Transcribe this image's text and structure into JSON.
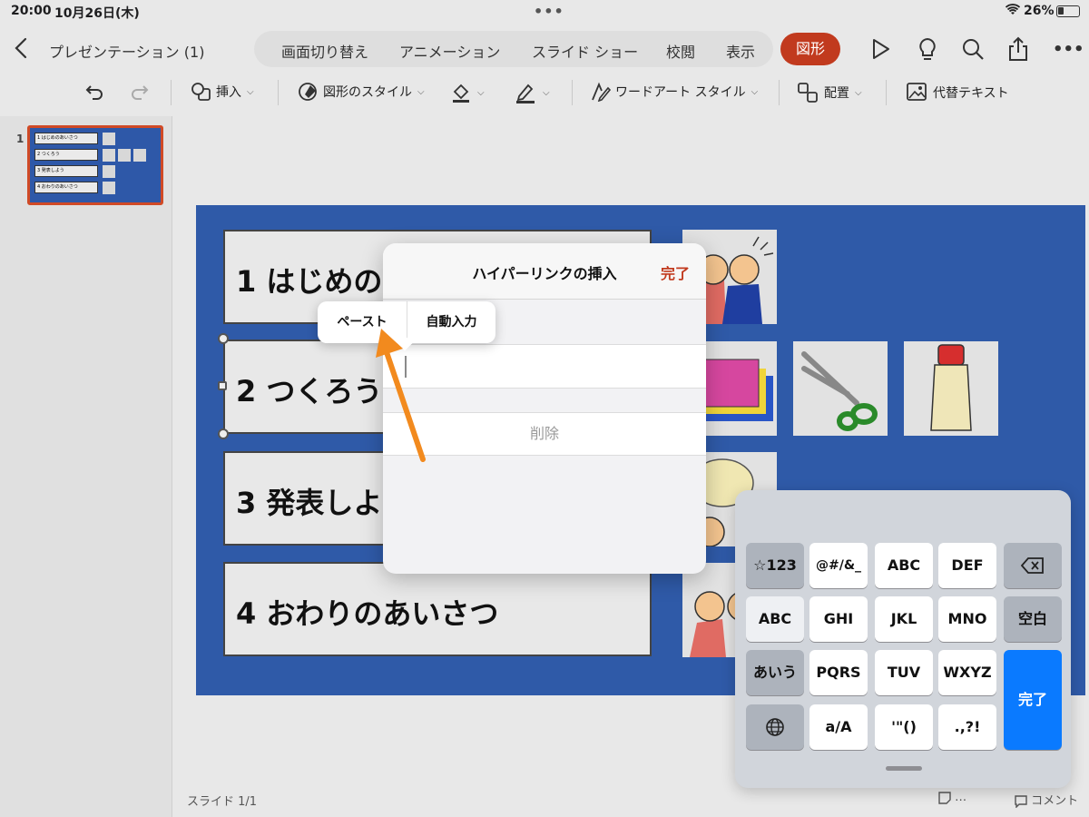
{
  "status_bar": {
    "time": "20:00",
    "date": "10月26日(木)",
    "battery": "26%"
  },
  "doc": {
    "title": "プレゼンテーション (1)"
  },
  "tabs": [
    {
      "label": "画面切り替え"
    },
    {
      "label": "アニメーション"
    },
    {
      "label": "スライド ショー"
    },
    {
      "label": "校閲"
    },
    {
      "label": "表示"
    }
  ],
  "active_tab": {
    "label": "図形"
  },
  "accent_color": "#c13a1e",
  "ribbon": {
    "insert": "挿入",
    "shape_style": "図形のスタイル",
    "wordart": "ワードアート スタイル",
    "arrange": "配置",
    "alt_text": "代替テキスト"
  },
  "thumbnail": {
    "number": "1",
    "items": [
      "1 はじめのあいさつ",
      "2 つくろう",
      "3 発表しよう",
      "4 おわりのあいさつ"
    ]
  },
  "slide": {
    "items": [
      "1 はじめの",
      "2 つくろう",
      "3 発表しよ",
      "4 おわりのあいさつ"
    ]
  },
  "dialog": {
    "title": "ハイパーリンクの挿入",
    "done": "完了",
    "delete": "削除"
  },
  "popover": {
    "paste": "ペースト",
    "autofill": "自動入力"
  },
  "keyboard": {
    "row1": [
      "☆123",
      "@#/&_",
      "ABC",
      "DEF"
    ],
    "row2": [
      "ABC",
      "GHI",
      "JKL",
      "MNO",
      "空白"
    ],
    "row3": [
      "あいう",
      "PQRS",
      "TUV",
      "WXYZ"
    ],
    "row4": [
      "a/A",
      "'\"()",
      ".,?!"
    ],
    "enter": "完了"
  },
  "footer": {
    "slide_count": "スライド 1/1",
    "notes": "…",
    "comment": "コメント"
  }
}
